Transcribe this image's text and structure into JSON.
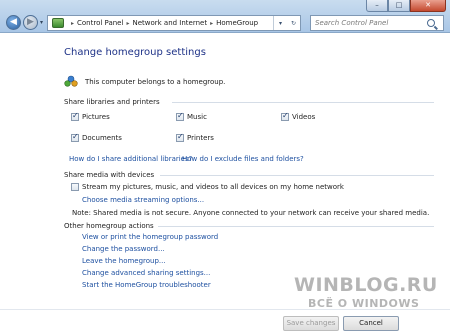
{
  "window": {
    "minimize_glyph": "–",
    "maximize_glyph": "□",
    "close_glyph": "✕"
  },
  "nav": {
    "back_glyph": "◀",
    "forward_glyph": "▶",
    "history_glyph": "▾"
  },
  "breadcrumb": {
    "items": [
      "Control Panel",
      "Network and Internet",
      "HomeGroup"
    ],
    "separator": "▸",
    "dropdown_glyph": "▾",
    "refresh_glyph": "↻"
  },
  "search": {
    "placeholder": "Search Control Panel"
  },
  "page": {
    "title": "Change homegroup settings",
    "membership_text": "This computer belongs to a homegroup."
  },
  "libraries": {
    "title": "Share libraries and printers",
    "items": [
      {
        "label": "Pictures",
        "checked": true
      },
      {
        "label": "Music",
        "checked": true
      },
      {
        "label": "Videos",
        "checked": true
      },
      {
        "label": "Documents",
        "checked": true
      },
      {
        "label": "Printers",
        "checked": true
      }
    ],
    "link_additional": "How do I share additional libraries?",
    "link_exclude": "How do I exclude files and folders?"
  },
  "media": {
    "title": "Share media with devices",
    "stream_label": "Stream my pictures, music, and videos to all devices on my home network",
    "stream_checked": false,
    "options_link": "Choose media streaming options...",
    "note": "Note: Shared media is not secure. Anyone connected to your network can receive your shared media."
  },
  "other": {
    "title": "Other homegroup actions",
    "links": [
      "View or print the homegroup password",
      "Change the password...",
      "Leave the homegroup...",
      "Change advanced sharing settings...",
      "Start the HomeGroup troubleshooter"
    ]
  },
  "footer": {
    "save_label": "Save changes",
    "cancel_label": "Cancel"
  },
  "watermark": {
    "title": "WINBLOG.RU",
    "subtitle": "ВСЁ О WINDOWS"
  },
  "colors": {
    "link": "#1e50a0",
    "heading": "#1e3287"
  }
}
